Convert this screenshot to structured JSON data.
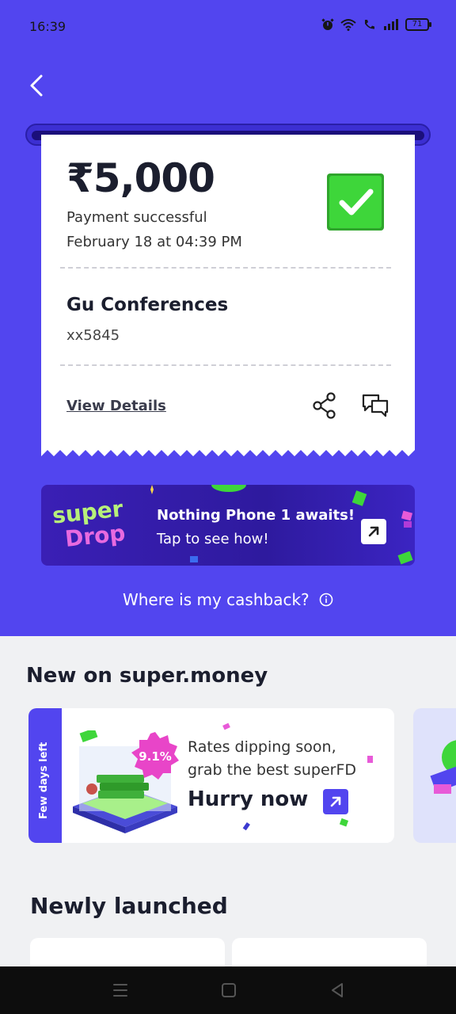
{
  "status_bar": {
    "time": "16:39",
    "battery": "71",
    "icons": [
      "alarm-icon",
      "wifi-icon",
      "call-icon",
      "signal-icon",
      "battery-icon"
    ]
  },
  "header": {
    "back_icon": "chevron-left-icon"
  },
  "receipt": {
    "amount": "₹5,000",
    "status": "Payment successful",
    "datetime": "February 18 at 04:39 PM",
    "merchant": "Gu Conferences",
    "account": "xx5845",
    "view_details": "View Details",
    "status_icon": "check-icon",
    "actions": [
      "share-icon",
      "chat-icon"
    ]
  },
  "promo": {
    "logo_line1": "super",
    "logo_line2": "Drop",
    "title": "Nothing Phone 1 awaits!",
    "subtitle": "Tap to see how!"
  },
  "cashback_link": "Where is my cashback?",
  "new_section": {
    "title": "New on super.money",
    "card": {
      "tab": "Few days left",
      "badge": "9.1%",
      "line1": "Rates dipping soon,",
      "line2": "grab the best superFD",
      "cta": "Hurry now"
    }
  },
  "launched_section": {
    "title": "Newly launched"
  },
  "colors": {
    "brand": "#5245ef",
    "success": "#3ed63a",
    "background": "#f0f1f3"
  }
}
